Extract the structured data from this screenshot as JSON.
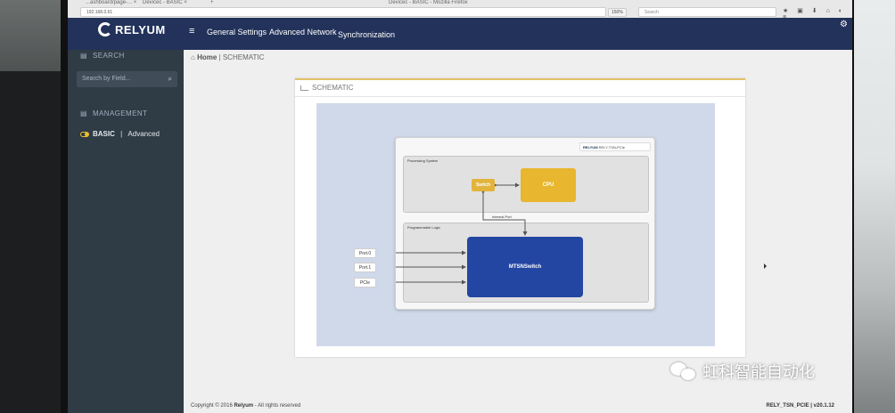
{
  "browser": {
    "tab1": "...ashboard/page-... ×",
    "tab2": "Devicec - BASIC ×",
    "window_title": "Devicec - BASIC - Mozilla Firefox",
    "url": "192.168.0.61",
    "zoom": "150%",
    "search_placeholder": "Search"
  },
  "header": {
    "logo": "RELYUM",
    "nav": [
      "General Settings",
      "Advanced Network",
      "Synchronization"
    ]
  },
  "sidebar": {
    "search_section": "SEARCH",
    "search_placeholder": "Search by Field...",
    "management_section": "MANAGEMENT",
    "item_basic": "BASIC",
    "item_separator": " | ",
    "item_advanced": "Advanced"
  },
  "breadcrumb": {
    "home": "Home",
    "separator": " | ",
    "current": "SCHEMATIC"
  },
  "panel": {
    "title": "SCHEMATIC"
  },
  "schematic": {
    "badge_logo": "RELYUM",
    "badge_model": "RELY-TSN-PCIe",
    "ps_title": "Processing System",
    "pl_title": "Programmable Logic",
    "switch_label": "Switch",
    "cpu_label": "CPU",
    "internal_port_label": "Internal Port",
    "mtsn_line1": "MTSN",
    "mtsn_line2": "Switch",
    "ports": [
      "Port.0",
      "Port.1",
      "PCIe"
    ]
  },
  "footer": {
    "copyright_prefix": "Copyright © 2016",
    "company": "Relyum",
    "rights": " - All rights reserved",
    "version": "RELY_TSN_PCIE | v20.1.12"
  },
  "watermark": {
    "text": "虹科智能自动化"
  },
  "colors": {
    "header_bg": "#22325a",
    "sidebar_bg": "#2f3b45",
    "accent_yellow": "#e8b62f",
    "mtsn_blue": "#2446a3"
  }
}
